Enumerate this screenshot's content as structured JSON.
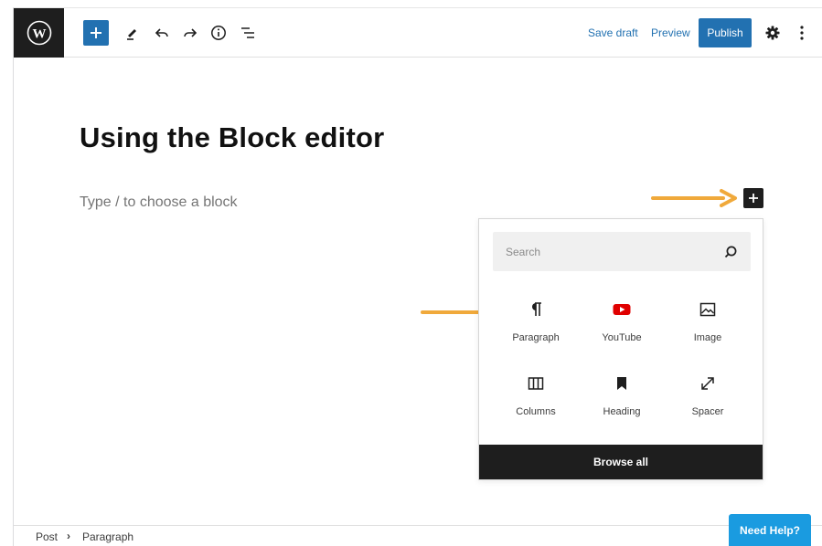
{
  "toolbar": {
    "logo_icon": "wordpress-logo",
    "add_block_icon": "plus-icon",
    "tools": [
      "pencil-icon",
      "undo-icon",
      "redo-icon",
      "info-icon",
      "list-view-icon"
    ],
    "save_draft_label": "Save draft",
    "preview_label": "Preview",
    "publish_label": "Publish",
    "settings_icon": "gear-icon",
    "options_icon": "kebab-icon"
  },
  "editor": {
    "post_title": "Using the Block editor",
    "block_placeholder": "Type / to choose a block",
    "inline_add_icon": "plus-icon"
  },
  "inserter": {
    "search_placeholder": "Search",
    "blocks": [
      {
        "label": "Paragraph",
        "icon": "paragraph-icon"
      },
      {
        "label": "YouTube",
        "icon": "youtube-icon"
      },
      {
        "label": "Image",
        "icon": "image-icon"
      },
      {
        "label": "Columns",
        "icon": "columns-icon"
      },
      {
        "label": "Heading",
        "icon": "bookmark-icon"
      },
      {
        "label": "Spacer",
        "icon": "resize-icon"
      }
    ],
    "browse_all_label": "Browse all"
  },
  "breadcrumb": {
    "items": [
      "Post",
      "Paragraph"
    ],
    "separator": "›"
  },
  "help": {
    "label": "Need Help?"
  },
  "colors": {
    "accent": "#2271b1",
    "dark": "#1e1e1e",
    "help": "#1a9be0",
    "annotation_arrow": "#f0a93b",
    "youtube_red": "#e00000"
  }
}
